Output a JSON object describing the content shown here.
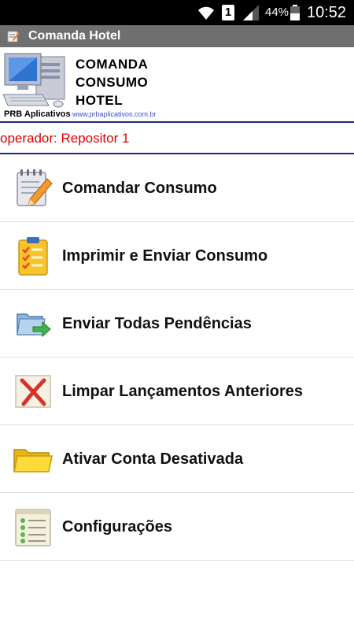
{
  "status_bar": {
    "sim_slot": "1",
    "battery_percent": "44%",
    "time": "10:52"
  },
  "title_bar": {
    "title": "Comanda Hotel",
    "icon": "edit-note-icon"
  },
  "banner": {
    "brand_lines": [
      "COMANDA",
      "CONSUMO",
      "HOTEL"
    ],
    "company": "PRB Aplicativos",
    "website": "www.prbaplicativos.com.br",
    "logo": "computer-logo"
  },
  "operator": {
    "text": "operador: Repositor 1",
    "color": "#e00000"
  },
  "menu": {
    "items": [
      {
        "label": "Comandar Consumo",
        "icon": "notepad-pencil-icon"
      },
      {
        "label": "Imprimir e Enviar Consumo",
        "icon": "clipboard-checklist-icon"
      },
      {
        "label": "Enviar Todas Pendências",
        "icon": "folder-send-arrow-icon"
      },
      {
        "label": "Limpar Lançamentos Anteriores",
        "icon": "red-x-icon"
      },
      {
        "label": "Ativar Conta Desativada",
        "icon": "yellow-folder-icon"
      },
      {
        "label": "Configurações",
        "icon": "settings-list-icon"
      }
    ]
  },
  "colors": {
    "title_bar": "#6f6f6f",
    "divider": "#1f2a86",
    "operator_text": "#e00000"
  }
}
